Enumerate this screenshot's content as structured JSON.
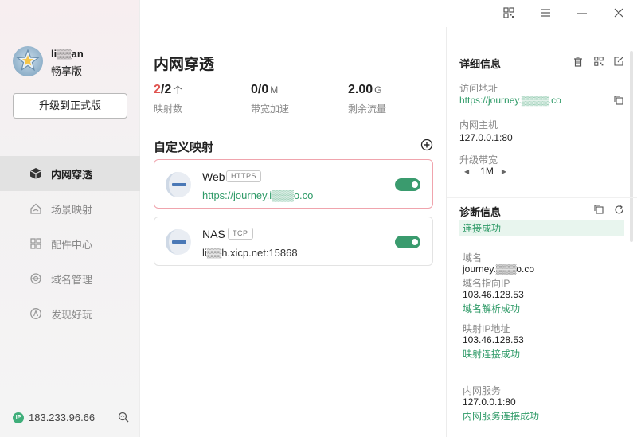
{
  "user": {
    "name": "li▒▒an",
    "plan": "畅享版"
  },
  "sidebar": {
    "upgrade_label": "升级到正式版",
    "items": [
      {
        "label": "内网穿透",
        "icon": "cube-icon",
        "active": true
      },
      {
        "label": "场景映射",
        "icon": "house-icon",
        "active": false
      },
      {
        "label": "配件中心",
        "icon": "grid-icon",
        "active": false
      },
      {
        "label": "域名管理",
        "icon": "globe-icon",
        "active": false
      },
      {
        "label": "发现好玩",
        "icon": "compass-icon",
        "active": false
      }
    ],
    "ip_badge": "IP",
    "ip": "183.233.96.66"
  },
  "main": {
    "title": "内网穿透",
    "stats": [
      {
        "value_accent": "2",
        "value_rest": "/2",
        "unit": "个",
        "label": "映射数"
      },
      {
        "value_accent": "",
        "value_rest": "0/0",
        "unit": "M",
        "label": "带宽加速"
      },
      {
        "value_accent": "",
        "value_rest": "2.00",
        "unit": "G",
        "label": "剩余流量"
      }
    ],
    "section_title": "自定义映射",
    "mappings": [
      {
        "name": "Web",
        "protocol": "HTTPS",
        "address": "https://journey.i▒▒▒o.co",
        "enabled": true
      },
      {
        "name": "NAS",
        "protocol": "TCP",
        "address": "li▒▒h.xicp.net:15868",
        "enabled": true
      }
    ]
  },
  "details": {
    "title": "详细信息",
    "access_label": "访问地址",
    "access_value": "https://journey.▒▒▒▒.co",
    "host_label": "内网主机",
    "host_value": "127.0.0.1:80",
    "bandwidth_label": "升级带宽",
    "bandwidth_value": "1M",
    "diag_title": "诊断信息",
    "diag_status": "连接成功",
    "domain_label": "域名",
    "domain_value": "journey.▒▒▒o.co",
    "domain_ip_label": "域名指向IP",
    "domain_ip_value": "103.46.128.53",
    "domain_resolve": "域名解析成功",
    "map_ip_label": "映射IP地址",
    "map_ip_value": "103.46.128.53",
    "map_connect": "映射连接成功",
    "service_label": "内网服务",
    "service_value": "127.0.0.1:80",
    "service_connect": "内网服务连接成功"
  },
  "colors": {
    "accent_green": "#2e9a67",
    "accent_red": "#e0534f",
    "toggle_on": "#3a9b6e"
  }
}
